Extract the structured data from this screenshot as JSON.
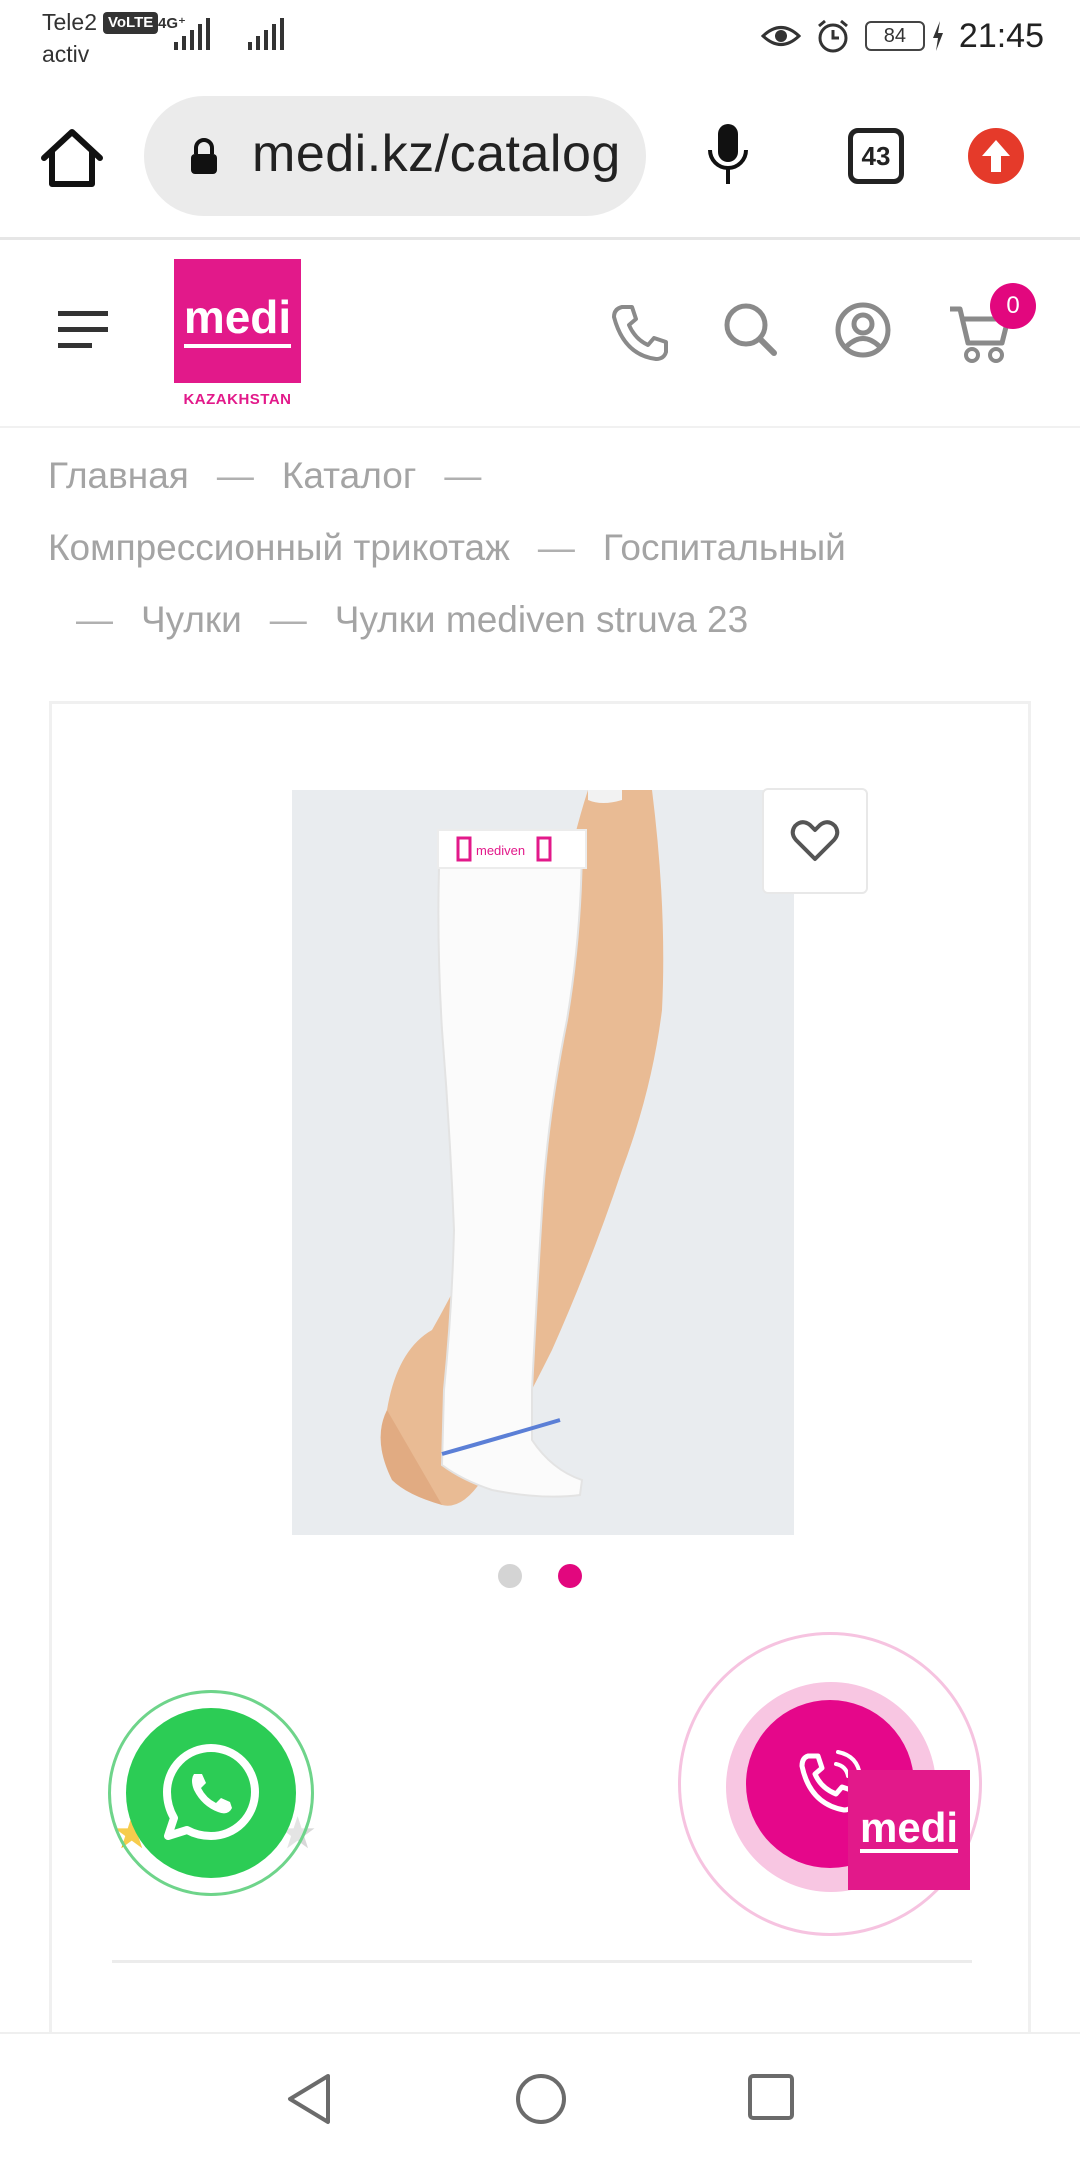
{
  "status_bar": {
    "carrier": "Tele2",
    "carrier_sub": "activ",
    "volte": "VoLTE",
    "network": "4G⁺",
    "battery": "84",
    "time": "21:45"
  },
  "browser": {
    "url": "medi.kz/catalog",
    "tab_count": "43"
  },
  "site_header": {
    "logo_word": "medi",
    "logo_sub": "KAZAKHSTAN",
    "cart_count": "0"
  },
  "breadcrumb": {
    "items": [
      "Главная",
      "Каталог",
      "Компрессионный трикотаж",
      "Госпитальный",
      "Чулки",
      "Чулки mediven struva 23"
    ],
    "separator": "—"
  },
  "product": {
    "image_band_brand": "mediven",
    "gallery_dots": 2,
    "active_dot": 2,
    "rating": 1,
    "rating_max": 5
  },
  "floating": {
    "mini_logo": "medi"
  },
  "colors": {
    "brand_pink": "#e2198a",
    "whatsapp_green": "#2ccc55"
  }
}
